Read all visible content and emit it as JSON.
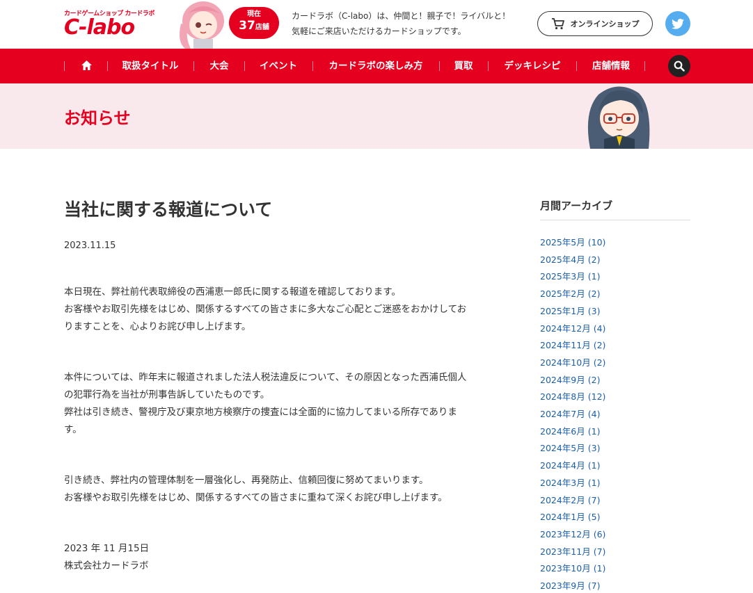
{
  "header": {
    "logo_sub": "カードゲームショップ カードラボ",
    "logo_main": "C-labo",
    "badge_top": "現在",
    "badge_count": "37",
    "badge_unit": "店舗",
    "tagline_line1": "カードラボ（C-labo）は、仲間と！親子で！ライバルと！",
    "tagline_line2": "気軽にご来店いただけるカードショップです。",
    "shop_button": "オンラインショップ"
  },
  "nav": {
    "items": [
      {
        "label": "取扱タイトル"
      },
      {
        "label": "大会"
      },
      {
        "label": "イベント"
      },
      {
        "label": "カードラボの楽しみ方"
      },
      {
        "label": "買取"
      },
      {
        "label": "デッキレシピ"
      },
      {
        "label": "店舗情報"
      }
    ]
  },
  "page_title": "お知らせ",
  "article": {
    "title": "当社に関する報道について",
    "date": "2023.11.15",
    "paragraphs": [
      "本日現在、弊社前代表取締役の西浦恵一郎氏に関する報道を確認しております。\nお客様やお取引先様をはじめ、関係するすべての皆さまに多大なご心配とご迷惑をおかけしてお\nりますことを、心よりお詫び申し上げます。",
      "本件については、昨年末に報道されました法人税法違反について、その原因となった西浦氏個人\nの犯罪行為を当社が刑事告訴していたものです。\n弊社は引き続き、警視庁及び東京地方検察庁の捜査には全面的に協力してまいる所存でありま\nす。",
      "引き続き、弊社内の管理体制を一層強化し、再発防止、信頼回復に努めてまいります。\nお客様やお取引先様をはじめ、関係するすべての皆さまに重ねて深くお詫び申し上げます。",
      "2023 年 11 月15日\n株式会社カードラボ"
    ]
  },
  "sidebar": {
    "title": "月間アーカイブ",
    "archives": [
      "2025年5月 (10)",
      "2025年4月 (2)",
      "2025年3月 (1)",
      "2025年2月 (2)",
      "2025年1月 (3)",
      "2024年12月 (4)",
      "2024年11月 (2)",
      "2024年10月 (2)",
      "2024年9月 (2)",
      "2024年8月 (12)",
      "2024年7月 (4)",
      "2024年6月 (1)",
      "2024年5月 (3)",
      "2024年4月 (1)",
      "2024年3月 (1)",
      "2024年2月 (7)",
      "2024年1月 (5)",
      "2023年12月 (6)",
      "2023年11月 (7)",
      "2023年10月 (1)",
      "2023年9月 (7)"
    ]
  },
  "colors": {
    "brand_red": "#e50020",
    "title_band": "#f9e8ec",
    "link_blue": "#1a5fae",
    "twitter_blue": "#55acee"
  },
  "icons": [
    "home-icon",
    "cart-icon",
    "twitter-icon",
    "search-icon"
  ]
}
